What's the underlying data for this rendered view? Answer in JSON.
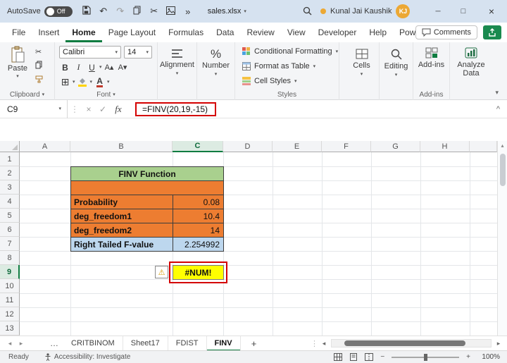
{
  "titlebar": {
    "autosave_label": "AutoSave",
    "autosave_state": "Off",
    "filename": "sales.xlsx",
    "user_name": "Kunal Jai Kaushik",
    "user_initials": "KJ"
  },
  "menubar": {
    "tabs": [
      "File",
      "Insert",
      "Home",
      "Page Layout",
      "Formulas",
      "Data",
      "Review",
      "View",
      "Developer",
      "Help",
      "Power Pivot"
    ],
    "active_tab": "Home",
    "comments_label": "Comments"
  },
  "ribbon": {
    "paste_label": "Paste",
    "clipboard_group_label": "Clipboard",
    "font_name": "Calibri",
    "font_size": "14",
    "bold_label": "B",
    "italic_label": "I",
    "underline_label": "U",
    "font_group_label": "Font",
    "alignment_label": "Alignment",
    "number_label": "Number",
    "conditional_formatting_label": "Conditional Formatting",
    "format_as_table_label": "Format as Table",
    "cell_styles_label": "Cell Styles",
    "styles_group_label": "Styles",
    "cells_label": "Cells",
    "editing_label": "Editing",
    "addins_label": "Add-ins",
    "addins_group_label": "Add-ins",
    "analyze_data_label": "Analyze Data"
  },
  "formula_bar": {
    "name_box": "C9",
    "fx_label": "fx",
    "formula": "=FINV(20,19,-15)"
  },
  "grid": {
    "columns": [
      "A",
      "B",
      "C",
      "D",
      "E",
      "F",
      "G",
      "H"
    ],
    "rows": [
      "1",
      "2",
      "3",
      "4",
      "5",
      "6",
      "7",
      "8",
      "9",
      "10",
      "11",
      "12",
      "13"
    ],
    "selected_column": "C",
    "selected_row": "9",
    "selected_cell": "C9"
  },
  "sheet_table": {
    "title": "FINV Function",
    "rows": [
      {
        "label": "Probability",
        "value": "0.08"
      },
      {
        "label": "deg_freedom1",
        "value": "10.4"
      },
      {
        "label": "deg_freedom2",
        "value": "14"
      },
      {
        "label": "Right Tailed F-value",
        "value": "2.254992"
      }
    ],
    "error_value": "#NUM!"
  },
  "tabs_bar": {
    "overflow": "…",
    "tabs": [
      "CRITBINOM",
      "Sheet17",
      "FDIST",
      "FINV"
    ],
    "active_tab": "FINV",
    "add_button": "+"
  },
  "status_bar": {
    "ready": "Ready",
    "accessibility": "Accessibility: Investigate",
    "zoom_level": "100%"
  },
  "icons": {
    "caret_down": "▾",
    "caret_up": "^",
    "undo": "↶",
    "redo": "↷",
    "scissors": "✂",
    "overflow_chevrons": "»",
    "ellipsis_vertical": "⋮",
    "cancel": "×",
    "check": "✓",
    "percent": "%",
    "borders": "⊞",
    "grow_font": "A▴",
    "shrink_font": "A▾",
    "font_color_letter": "A",
    "warning": "⚠",
    "minimize": "─",
    "maximize": "□",
    "close": "×",
    "scroll_left": "◂",
    "scroll_right": "▸",
    "scroll_up": "▴",
    "minus": "−",
    "plus": "+"
  },
  "colors": {
    "excel_green": "#107C41",
    "table_title_green": "#A9D08E",
    "input_orange": "#ED7D31",
    "result_blue": "#BDD7EE",
    "error_yellow": "#FFFF00",
    "annotation_red": "#D40000",
    "avatar_gold": "#ECA834",
    "titlebar_blue": "#D6E2F0"
  }
}
